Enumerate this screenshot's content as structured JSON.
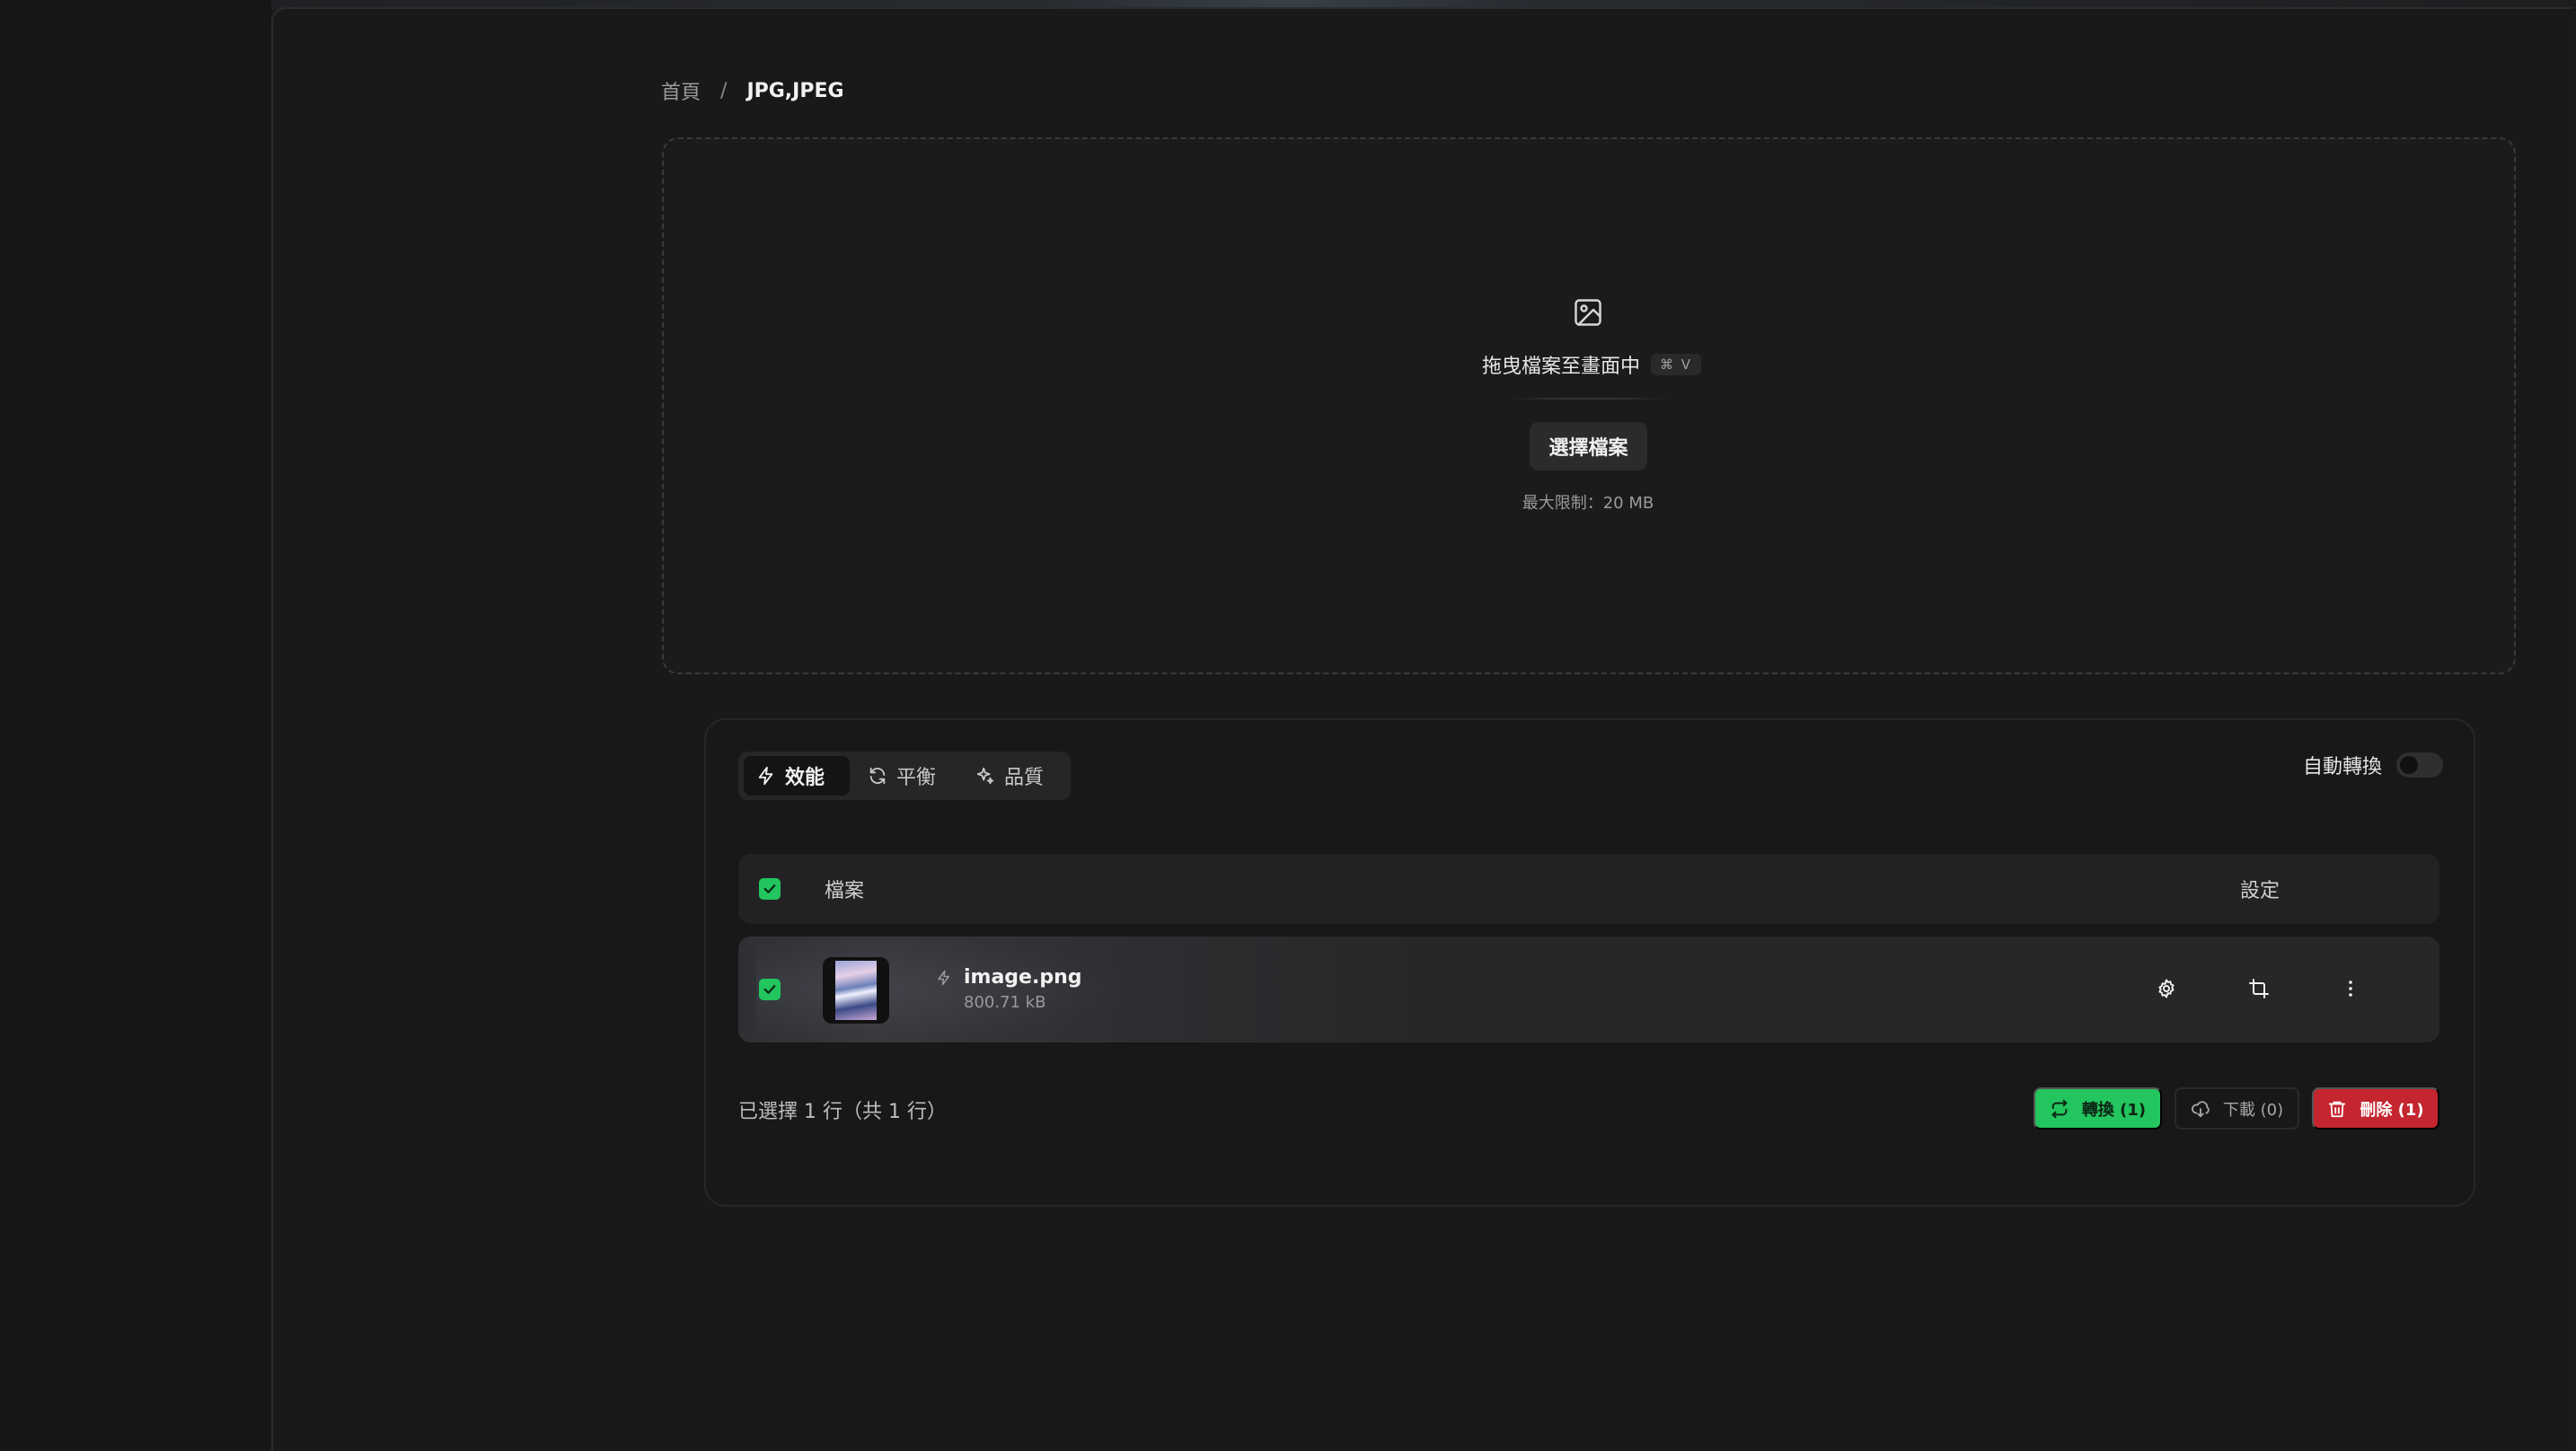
{
  "breadcrumb": {
    "home": "首頁",
    "separator": "/",
    "current": "JPG,JPEG"
  },
  "dropzone": {
    "icon": "image-icon",
    "text": "拖曳檔案至畫面中",
    "shortcut": "⌘ V",
    "choose_button": "選擇檔案",
    "limit": "最大限制：20 MB"
  },
  "modes": {
    "items": [
      {
        "label": "效能",
        "icon": "bolt-icon",
        "active": true
      },
      {
        "label": "平衡",
        "icon": "refresh-icon",
        "active": false
      },
      {
        "label": "品質",
        "icon": "sparkles-icon",
        "active": false
      }
    ]
  },
  "auto_convert": {
    "label": "自動轉換",
    "enabled": false
  },
  "table": {
    "headers": {
      "file": "檔案",
      "settings": "設定"
    },
    "rows": [
      {
        "name": "image.png",
        "size": "800.71 kB",
        "selected": true,
        "mode_icon": "bolt-icon"
      }
    ]
  },
  "footer": {
    "selection": "已選擇 1 行（共 1 行）",
    "convert_label": "轉換 (1)",
    "download_label": "下載 (0)",
    "delete_label": "刪除 (1)"
  },
  "colors": {
    "accent_green": "#22c55e",
    "danger_red": "#c4252e",
    "background": "#191919"
  }
}
